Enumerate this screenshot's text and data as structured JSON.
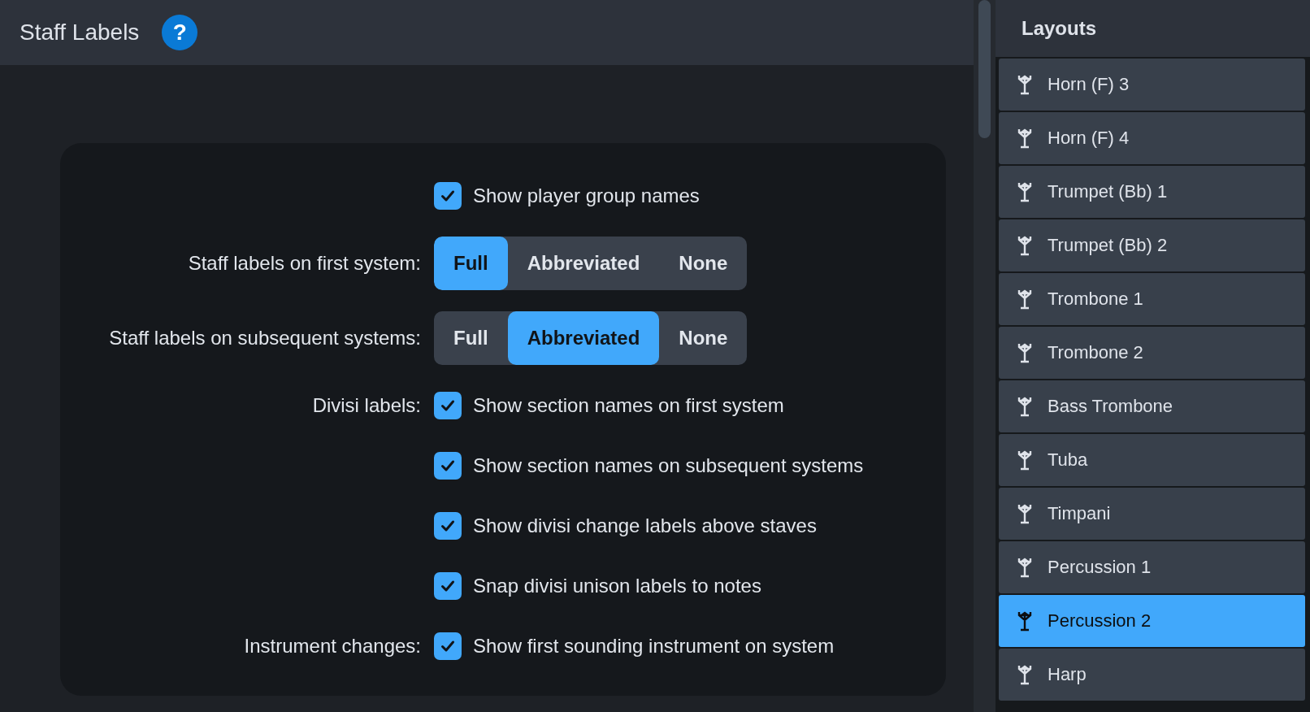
{
  "header": {
    "title": "Staff Labels",
    "help_icon": "?"
  },
  "options": [
    {
      "kind": "checkbox",
      "text": "Show player group names",
      "checked": true
    },
    {
      "kind": "segmented",
      "label": "Staff labels on first system:",
      "choices": [
        {
          "label": "Full",
          "selected": true
        },
        {
          "label": "Abbreviated",
          "selected": false
        },
        {
          "label": "None",
          "selected": false
        }
      ]
    },
    {
      "kind": "segmented",
      "label": "Staff labels on subsequent systems:",
      "choices": [
        {
          "label": "Full",
          "selected": false
        },
        {
          "label": "Abbreviated",
          "selected": true
        },
        {
          "label": "None",
          "selected": false
        }
      ]
    },
    {
      "kind": "checkbox",
      "label": "Divisi labels:",
      "text": "Show section names on first system",
      "checked": true
    },
    {
      "kind": "checkbox",
      "text": "Show section names on subsequent systems",
      "checked": true
    },
    {
      "kind": "checkbox",
      "text": "Show divisi change labels above staves",
      "checked": true
    },
    {
      "kind": "checkbox",
      "text": "Snap divisi unison labels to notes",
      "checked": true
    },
    {
      "kind": "checkbox",
      "label": "Instrument changes:",
      "text": "Show first sounding instrument on system",
      "checked": true
    }
  ],
  "layouts": {
    "title": "Layouts",
    "items": [
      {
        "label": "Horn (F) 3",
        "selected": false
      },
      {
        "label": "Horn (F) 4",
        "selected": false
      },
      {
        "label": "Trumpet (Bb) 1",
        "selected": false
      },
      {
        "label": "Trumpet (Bb) 2",
        "selected": false
      },
      {
        "label": "Trombone 1",
        "selected": false
      },
      {
        "label": "Trombone 2",
        "selected": false
      },
      {
        "label": "Bass Trombone",
        "selected": false
      },
      {
        "label": "Tuba",
        "selected": false
      },
      {
        "label": "Timpani",
        "selected": false
      },
      {
        "label": "Percussion 1",
        "selected": false
      },
      {
        "label": "Percussion 2",
        "selected": true
      },
      {
        "label": "Harp",
        "selected": false
      }
    ]
  }
}
